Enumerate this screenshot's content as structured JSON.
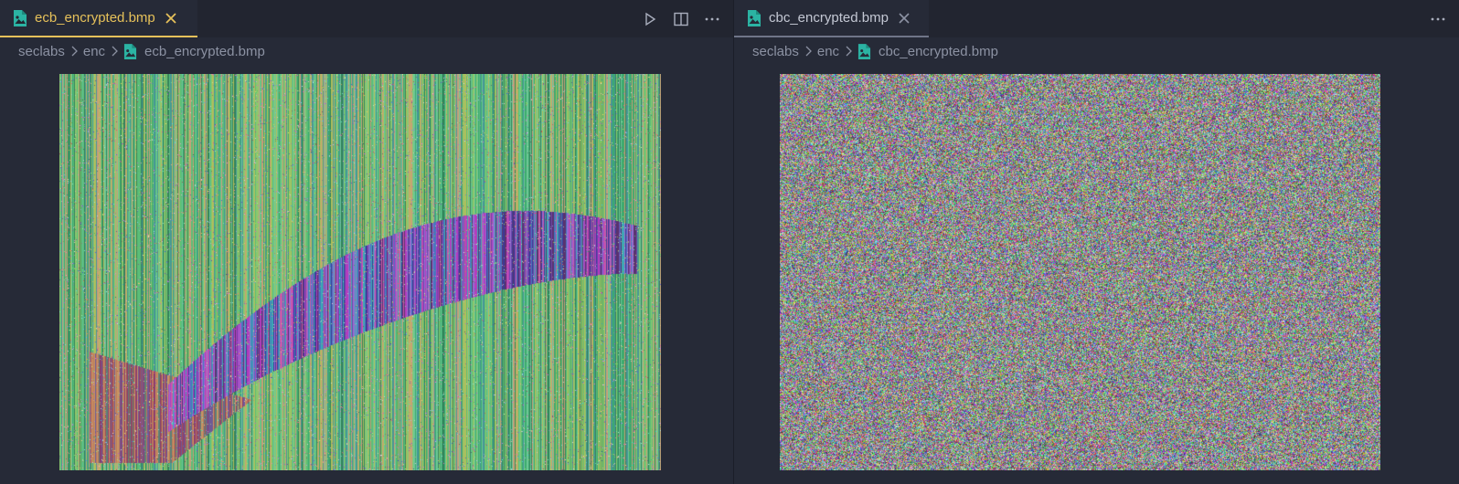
{
  "editor_left": {
    "tab": {
      "label": "ecb_encrypted.bmp",
      "icon": "image-file-icon",
      "active": true
    },
    "actions": [
      "run-icon",
      "split-editor-icon",
      "more-actions-icon"
    ],
    "breadcrumb": [
      "seclabs",
      "enc",
      "ecb_encrypted.bmp"
    ]
  },
  "editor_right": {
    "tab": {
      "label": "cbc_encrypted.bmp",
      "icon": "image-file-icon",
      "active": false
    },
    "actions": [
      "more-actions-icon"
    ],
    "breadcrumb": [
      "seclabs",
      "enc",
      "cbc_encrypted.bmp"
    ]
  },
  "colors": {
    "background": "#262a37",
    "tabbar": "#222530",
    "active_tab_accent": "#e6c15a",
    "icon_teal": "#2bb3a3",
    "text": "#8c92a3"
  }
}
